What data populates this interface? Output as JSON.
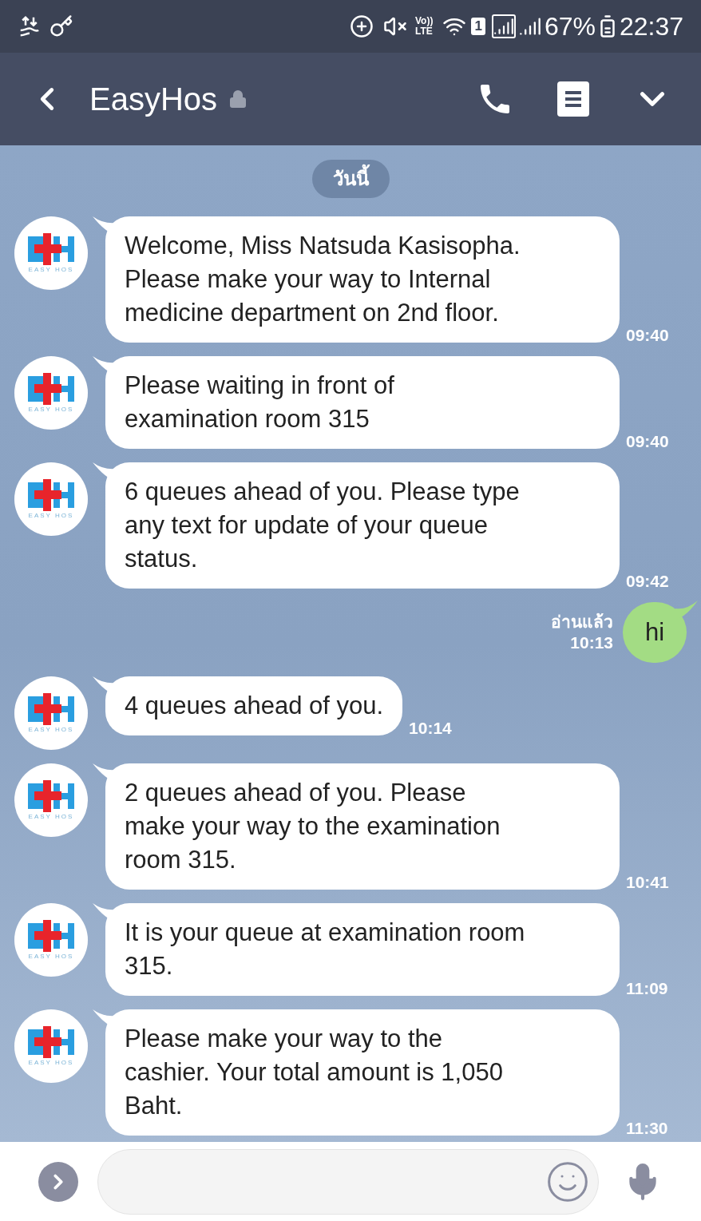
{
  "status_bar": {
    "vo_label": "Vo))",
    "lte_label": "LTE",
    "sim_slot": "1",
    "battery": "67%",
    "time": "22:37"
  },
  "header": {
    "title": "EasyHos",
    "locked": true
  },
  "date_pill": "วันนี้",
  "messages": [
    {
      "kind": "incoming",
      "text": "Welcome, Miss Natsuda Kasisopha.\nPlease make your way to Internal\nmedicine department on 2nd floor.",
      "time": "09:40",
      "avatar_caption": "EASY HOS"
    },
    {
      "kind": "incoming",
      "text": "Please waiting in front of\nexamination room 315",
      "time": "09:40",
      "avatar_caption": "EASY HOS"
    },
    {
      "kind": "incoming",
      "text": "6 queues ahead of you. Please type\nany text for update of your queue\nstatus.",
      "time": "09:42",
      "avatar_caption": "EASY HOS"
    },
    {
      "kind": "outgoing",
      "text": "hi",
      "time": "10:13",
      "read_label": "อ่านแล้ว"
    },
    {
      "kind": "incoming",
      "text": "4 queues ahead of you.",
      "time": "10:14",
      "avatar_caption": "EASY HOS"
    },
    {
      "kind": "incoming",
      "text": "2 queues ahead of you. Please\nmake your way to the examination\nroom 315.",
      "time": "10:41",
      "avatar_caption": "EASY HOS"
    },
    {
      "kind": "incoming",
      "text": "It is your queue at examination room\n315.",
      "time": "11:09",
      "avatar_caption": "EASY HOS"
    },
    {
      "kind": "incoming",
      "text": "Please make your way to the\ncashier. Your total amount is 1,050\nBaht.",
      "time": "11:30",
      "avatar_caption": "EASY HOS"
    }
  ]
}
